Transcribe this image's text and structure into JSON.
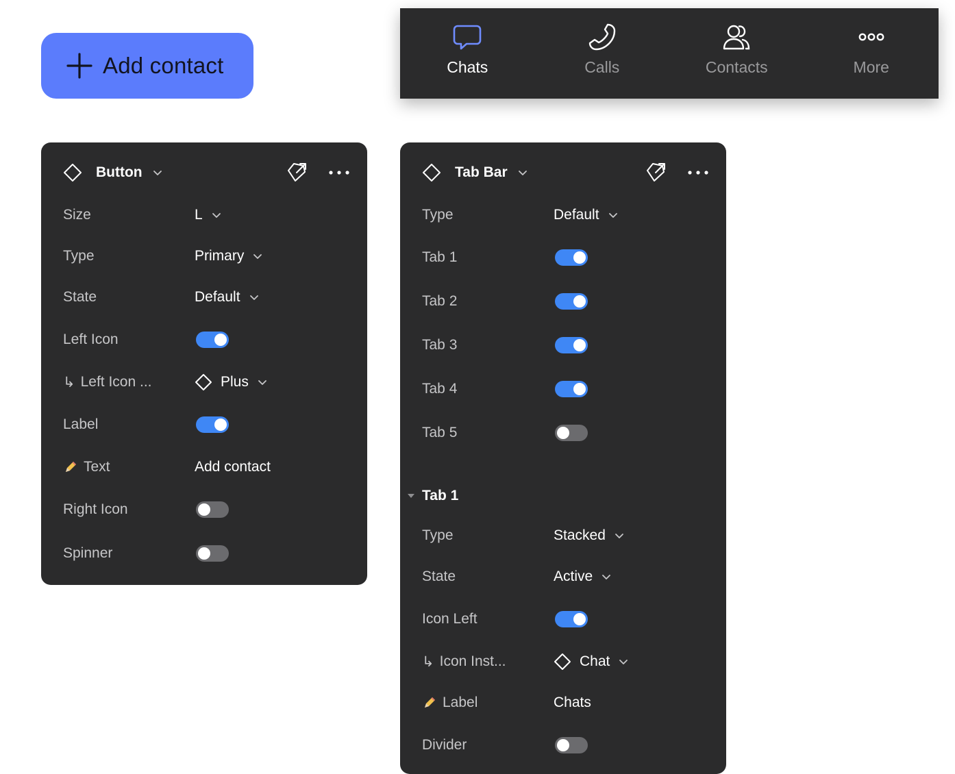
{
  "button_preview": {
    "label": "Add contact",
    "color": "#5b7cfc"
  },
  "tab_bar_preview": {
    "tabs": [
      {
        "label": "Chats",
        "icon": "chat-bubble-icon",
        "active": true
      },
      {
        "label": "Calls",
        "icon": "phone-icon",
        "active": false
      },
      {
        "label": "Contacts",
        "icon": "users-icon",
        "active": false
      },
      {
        "label": "More",
        "icon": "more-dots-icon",
        "active": false
      }
    ]
  },
  "button_panel": {
    "title": "Button",
    "props": {
      "size": {
        "label": "Size",
        "value": "L"
      },
      "type": {
        "label": "Type",
        "value": "Primary"
      },
      "state": {
        "label": "State",
        "value": "Default"
      },
      "left_icon": {
        "label": "Left Icon",
        "on": true
      },
      "left_icon_instance": {
        "label": "Left Icon ...",
        "value": "Plus"
      },
      "label": {
        "label": "Label",
        "on": true
      },
      "text": {
        "label": "Text",
        "value": "Add contact"
      },
      "right_icon": {
        "label": "Right Icon",
        "on": false
      },
      "spinner": {
        "label": "Spinner",
        "on": false
      }
    }
  },
  "tab_bar_panel": {
    "title": "Tab Bar",
    "props": {
      "type": {
        "label": "Type",
        "value": "Default"
      },
      "tab1": {
        "label": "Tab 1",
        "on": true
      },
      "tab2": {
        "label": "Tab 2",
        "on": true
      },
      "tab3": {
        "label": "Tab 3",
        "on": true
      },
      "tab4": {
        "label": "Tab 4",
        "on": true
      },
      "tab5": {
        "label": "Tab 5",
        "on": false
      }
    },
    "nested": {
      "title": "Tab 1",
      "type": {
        "label": "Type",
        "value": "Stacked"
      },
      "state": {
        "label": "State",
        "value": "Active"
      },
      "icon_left": {
        "label": "Icon Left",
        "on": true
      },
      "icon_instance": {
        "label": "Icon Inst...",
        "value": "Chat"
      },
      "label": {
        "label": "Label",
        "value": "Chats"
      },
      "divider": {
        "label": "Divider",
        "on": false
      }
    }
  },
  "colors": {
    "panel_bg": "#2b2b2c",
    "toggle_on": "#3f87f5",
    "toggle_off": "#6b6b6e",
    "tab_active_icon": "#6f8cff"
  }
}
